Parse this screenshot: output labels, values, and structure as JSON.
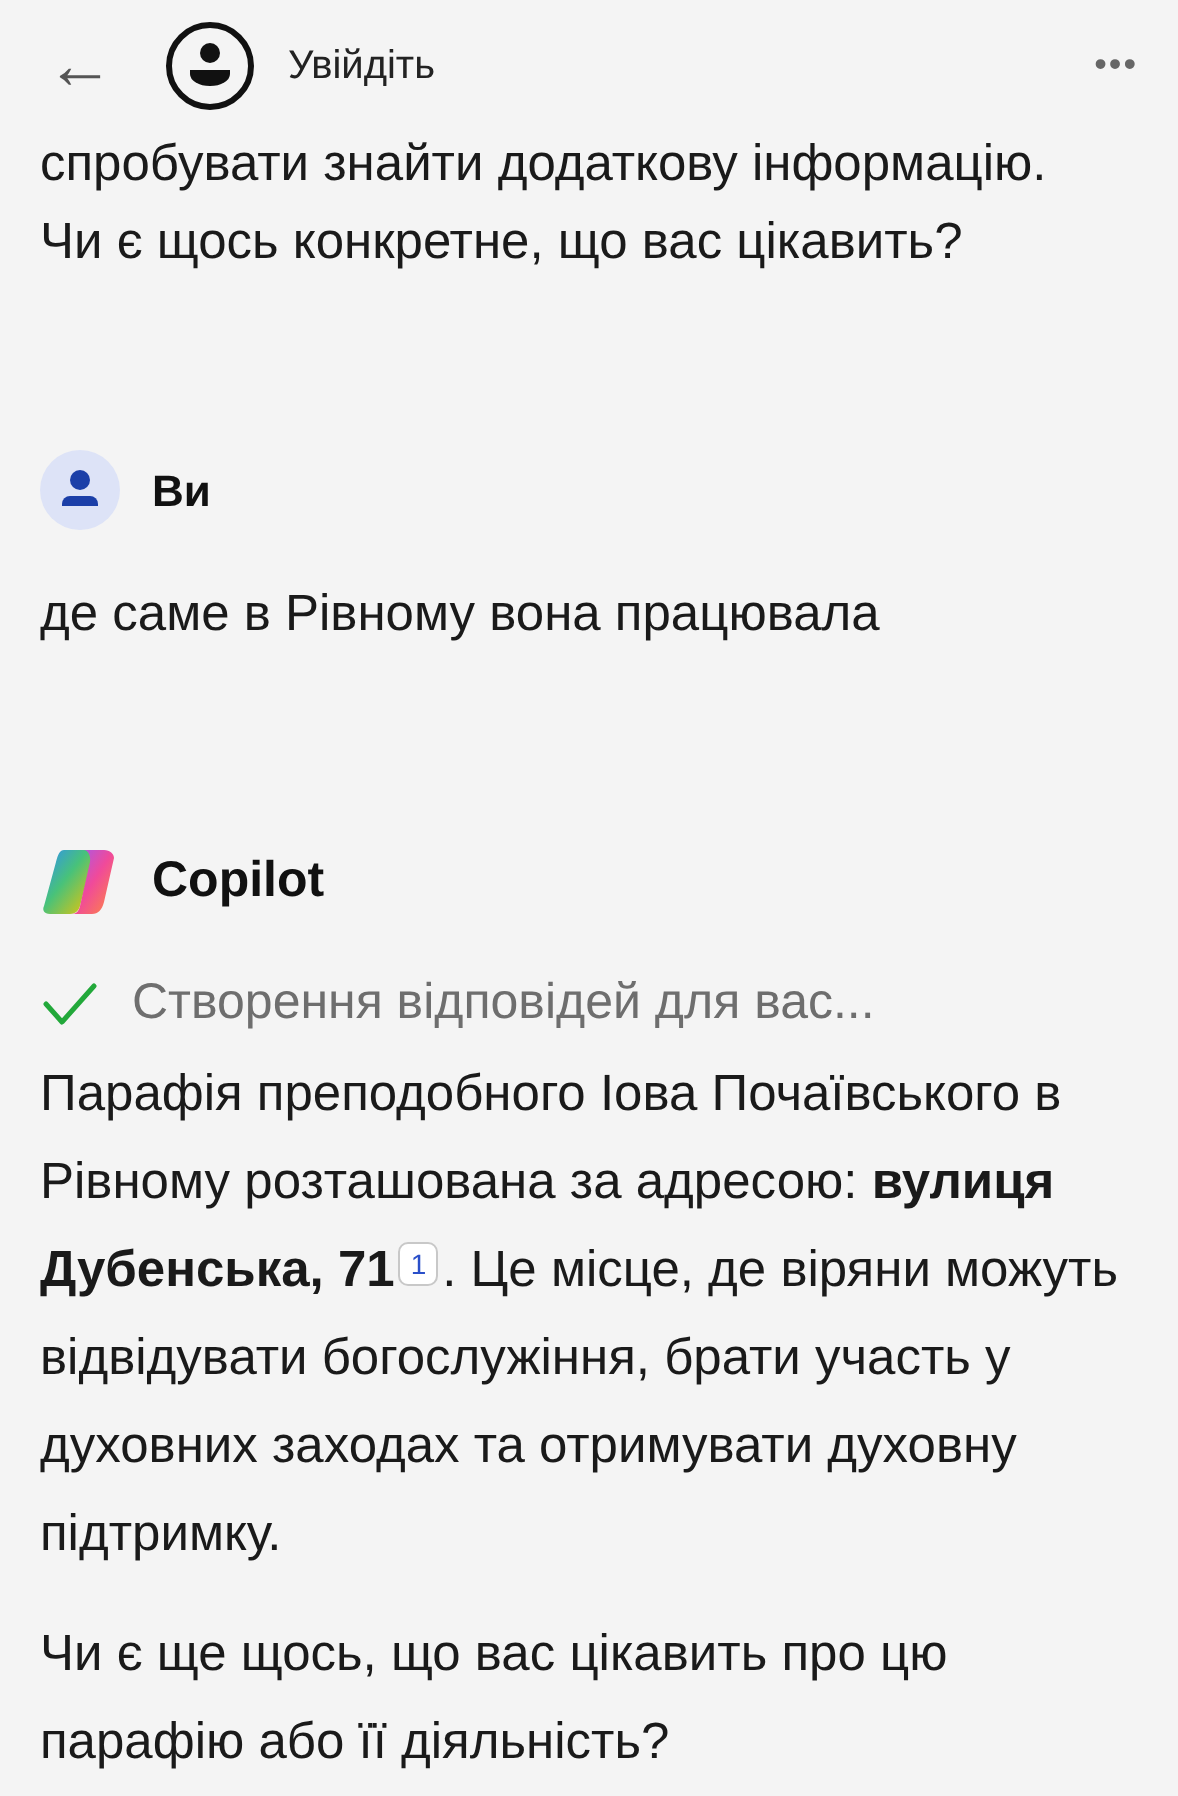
{
  "header": {
    "back": "←",
    "sign_in": "Увійдіть",
    "more": "•••"
  },
  "messages": [
    {
      "kind": "tail",
      "paragraphs": [
        "спробувати знайти додаткову інформацію.",
        "Чи є щось конкретне, що вас цікавить?"
      ]
    },
    {
      "kind": "user",
      "author": "Ви",
      "paragraphs": [
        "де саме в Рівному вона працювала"
      ]
    },
    {
      "kind": "bot",
      "author": "Copilot",
      "status": {
        "text": "Створення відповідей для вас...",
        "done": true
      },
      "answer": {
        "before": "Парафія преподобного Іова Почаївського в Рівному розташована за адресою: **вулиця Дубенська, 71**",
        "citation": "1",
        "after": ". Це місце, де віряни можуть відвідувати богослужіння, брати участь у духовних заходах та отримувати духовну підтримку."
      },
      "paragraphs": [
        "Чи є ще щось, що вас цікавить про цю парафію або її діяльність?"
      ]
    }
  ]
}
